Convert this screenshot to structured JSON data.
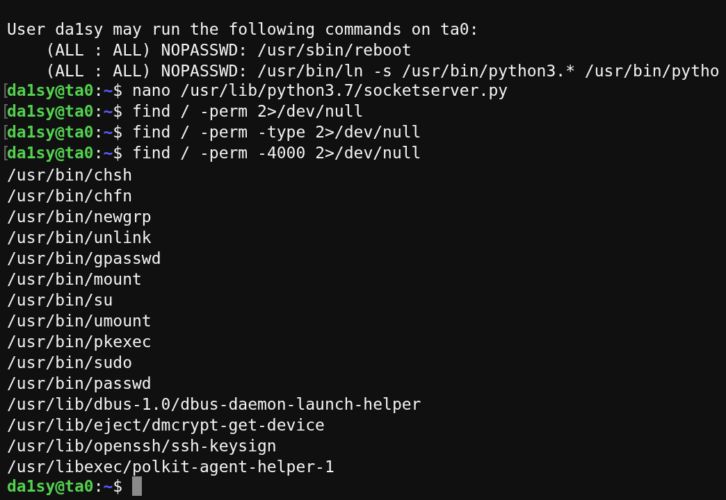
{
  "terminal": {
    "lines": [
      {
        "kind": "output",
        "text": "User da1sy may run the following commands on ta0:"
      },
      {
        "kind": "output",
        "text": "    (ALL : ALL) NOPASSWD: /usr/sbin/reboot"
      },
      {
        "kind": "output",
        "text": "    (ALL : ALL) NOPASSWD: /usr/bin/ln -s /usr/bin/python3.* /usr/bin/pytho"
      },
      {
        "kind": "prompt",
        "bracket": "[",
        "user_host": "da1sy@ta0",
        "separator": ":",
        "path": "~",
        "symbol": "$",
        "command": "nano /usr/lib/python3.7/socketserver.py",
        "cursor": false
      },
      {
        "kind": "prompt",
        "bracket": "[",
        "user_host": "da1sy@ta0",
        "separator": ":",
        "path": "~",
        "symbol": "$",
        "command": "find / -perm 2>/dev/null",
        "cursor": false
      },
      {
        "kind": "prompt",
        "bracket": "[",
        "user_host": "da1sy@ta0",
        "separator": ":",
        "path": "~",
        "symbol": "$",
        "command": "find / -perm -type 2>/dev/null",
        "cursor": false
      },
      {
        "kind": "prompt",
        "bracket": "[",
        "user_host": "da1sy@ta0",
        "separator": ":",
        "path": "~",
        "symbol": "$",
        "command": "find / -perm -4000 2>/dev/null",
        "cursor": false
      },
      {
        "kind": "output",
        "text": "/usr/bin/chsh"
      },
      {
        "kind": "output",
        "text": "/usr/bin/chfn"
      },
      {
        "kind": "output",
        "text": "/usr/bin/newgrp"
      },
      {
        "kind": "output",
        "text": "/usr/bin/unlink"
      },
      {
        "kind": "output",
        "text": "/usr/bin/gpasswd"
      },
      {
        "kind": "output",
        "text": "/usr/bin/mount"
      },
      {
        "kind": "output",
        "text": "/usr/bin/su"
      },
      {
        "kind": "output",
        "text": "/usr/bin/umount"
      },
      {
        "kind": "output",
        "text": "/usr/bin/pkexec"
      },
      {
        "kind": "output",
        "text": "/usr/bin/sudo"
      },
      {
        "kind": "output",
        "text": "/usr/bin/passwd"
      },
      {
        "kind": "output",
        "text": "/usr/lib/dbus-1.0/dbus-daemon-launch-helper"
      },
      {
        "kind": "output",
        "text": "/usr/lib/eject/dmcrypt-get-device"
      },
      {
        "kind": "output",
        "text": "/usr/lib/openssh/ssh-keysign"
      },
      {
        "kind": "output",
        "text": "/usr/libexec/polkit-agent-helper-1"
      },
      {
        "kind": "prompt",
        "user_host": "da1sy@ta0",
        "separator": ":",
        "path": "~",
        "symbol": "$",
        "cursor": true
      }
    ]
  }
}
